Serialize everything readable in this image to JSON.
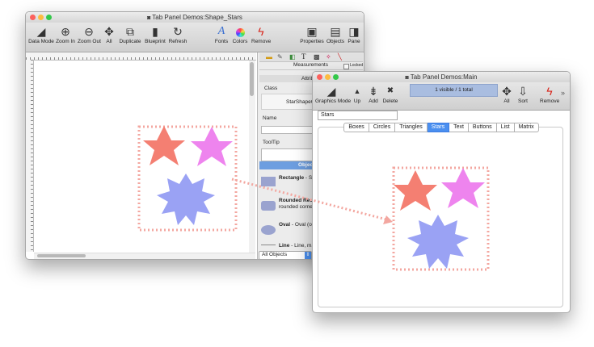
{
  "back_window": {
    "title": "Tab Panel Demos:Shape_Stars",
    "toolbar": [
      {
        "label": "Data Mode",
        "icon": "data-mode-icon",
        "glyph": "◢"
      },
      {
        "label": "Zoom In",
        "icon": "zoom-in-icon",
        "glyph": "⊕"
      },
      {
        "label": "Zoom Out",
        "icon": "zoom-out-icon",
        "glyph": "⊖"
      },
      {
        "label": "All",
        "icon": "all-icon",
        "glyph": "✥"
      },
      {
        "label": "Duplicate",
        "icon": "duplicate-icon",
        "glyph": "⧉"
      },
      {
        "label": "Blueprint",
        "icon": "blueprint-icon",
        "glyph": "▮"
      },
      {
        "label": "Refresh",
        "icon": "refresh-icon",
        "glyph": "↻"
      },
      {
        "label": "Fonts",
        "icon": "fonts-icon",
        "glyph": "A"
      },
      {
        "label": "Colors",
        "icon": "colors-icon",
        "glyph": "●"
      },
      {
        "label": "Remove",
        "icon": "remove-icon",
        "glyph": "ϟ"
      },
      {
        "label": "Properties",
        "icon": "properties-icon",
        "glyph": "▣"
      },
      {
        "label": "Objects",
        "icon": "objects-icon",
        "glyph": "▤"
      },
      {
        "label": "Pane",
        "icon": "pane-icon",
        "glyph": "◨"
      }
    ],
    "inspector": {
      "measurements_label": "Measurements",
      "locked_label": "Locked",
      "attributes_label": "Attrib",
      "class_label": "Class",
      "class_value": "StarShapeOb",
      "name_label": "Name",
      "tooltip_label": "ToolTip",
      "objects_header": "Object l",
      "objects": [
        {
          "title": "Rectangle",
          "desc": " - Si may be filled o",
          "color": "#9aa3cf",
          "shape": "rect"
        },
        {
          "title": "Rounded Rect",
          "desc": " Rectangle (or s rounded corne",
          "color": "#9aa3cf",
          "shape": "rounded"
        },
        {
          "title": "Oval",
          "desc": " - Oval (or filled or transpa",
          "color": "#9aa3cf",
          "shape": "oval"
        },
        {
          "title": "Line",
          "desc": " - Line, ma",
          "color": "#888888",
          "shape": "line"
        }
      ],
      "filter_value": "All Objects"
    }
  },
  "front_window": {
    "title": "Tab Panel Demos:Main",
    "toolbar": [
      {
        "label": "Graphics Mode",
        "icon": "graphics-mode-icon",
        "glyph": "◢"
      },
      {
        "label": "Up",
        "icon": "up-icon",
        "glyph": "▲"
      },
      {
        "label": "Add",
        "icon": "add-icon",
        "glyph": "⇟"
      },
      {
        "label": "Delete",
        "icon": "delete-icon",
        "glyph": "✖"
      },
      {
        "label": "All",
        "icon": "all-icon",
        "glyph": "✥"
      },
      {
        "label": "Sort",
        "icon": "sort-icon",
        "glyph": "⇩"
      },
      {
        "label": "Remove",
        "icon": "remove-icon",
        "glyph": "ϟ"
      }
    ],
    "status": "1 visible / 1 total",
    "overflow": "»",
    "field_value": "Stars",
    "tabs": [
      "Boxes",
      "Circles",
      "Triangles",
      "Stars",
      "Text",
      "Buttons",
      "List",
      "Matrix"
    ],
    "selected_tab": "Stars"
  },
  "colors": {
    "star_red": "#f47f72",
    "star_pink": "#ee84ee",
    "star_blue": "#9aa2f4",
    "selection_dots": "#f3a7a0",
    "tab_selected": "#4a8ff0",
    "status_bar": "#a9bde0"
  }
}
